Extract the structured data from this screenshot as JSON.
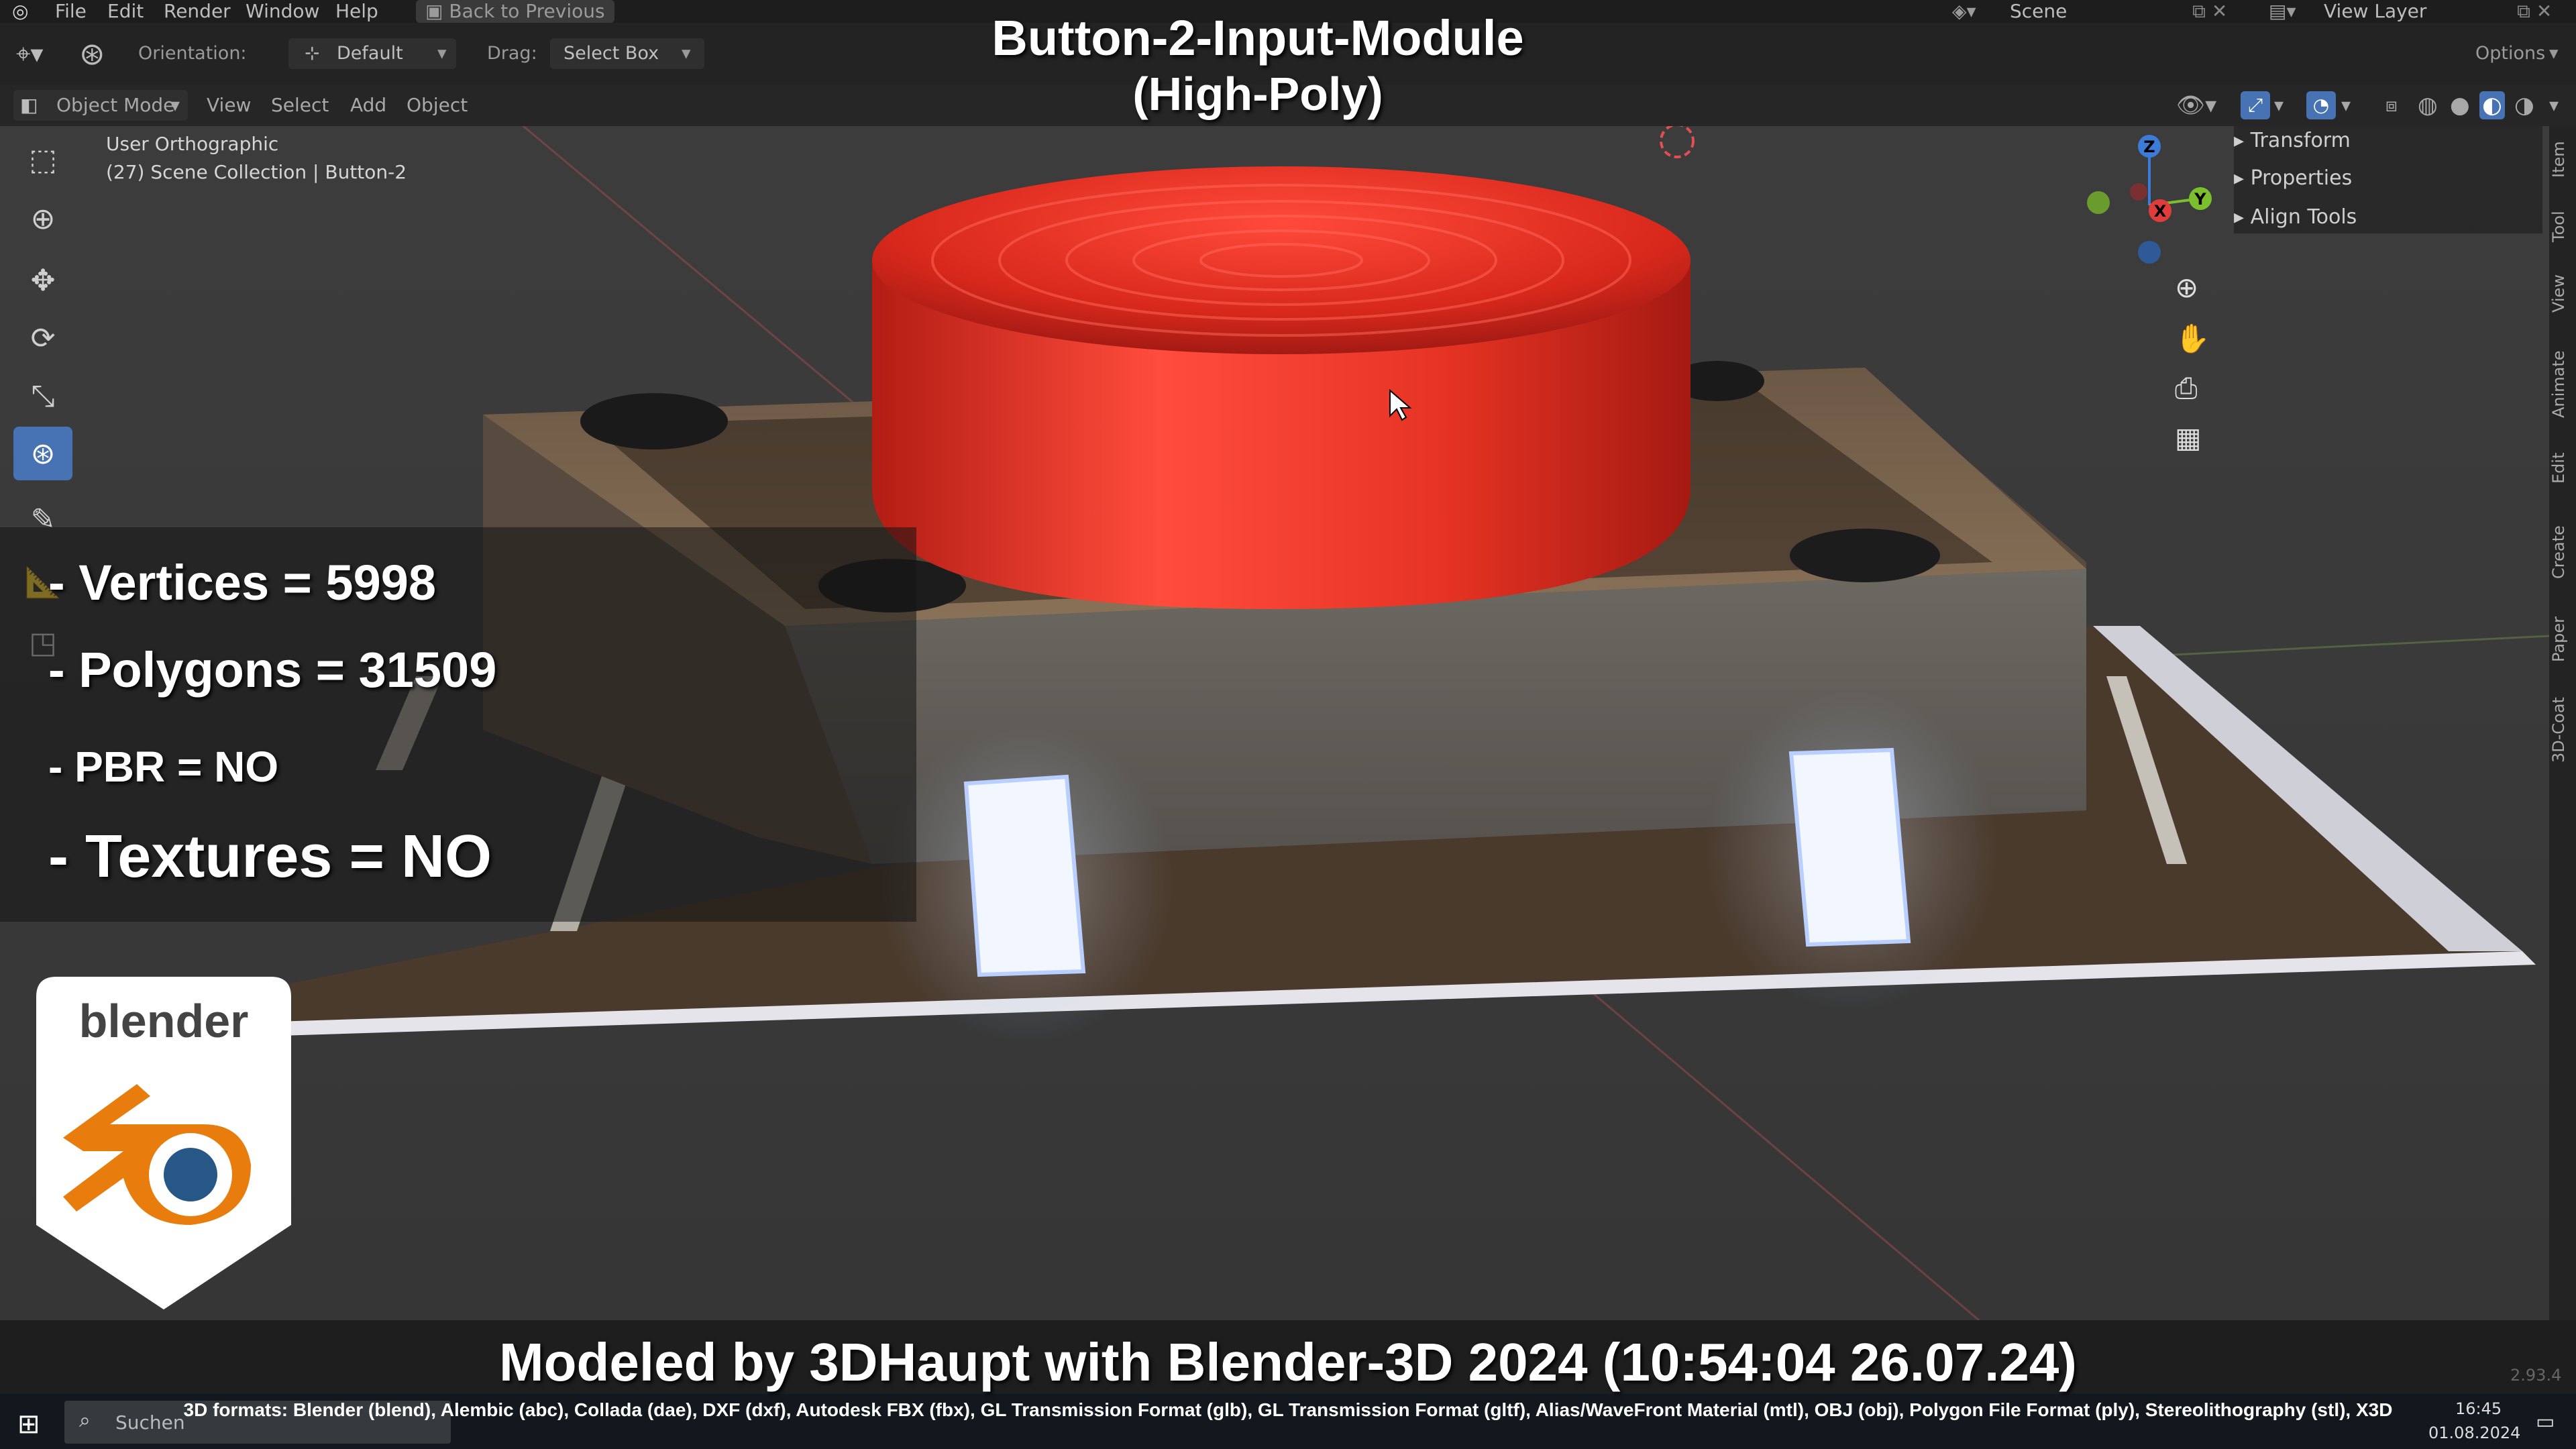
{
  "menu": {
    "items": [
      "File",
      "Edit",
      "Render",
      "Window",
      "Help"
    ],
    "back_label": "Back to Previous",
    "scene_label": "Scene",
    "view_layer_label": "View Layer"
  },
  "toolbar": {
    "orientation_label": "Orientation:",
    "orientation_value": "Default",
    "drag_label": "Drag:",
    "drag_value": "Select Box",
    "options_label": "Options"
  },
  "header": {
    "mode": "Object Mode",
    "menus": [
      "View",
      "Select",
      "Add",
      "Object"
    ]
  },
  "viewport": {
    "view_name": "User Orthographic",
    "collection": "(27) Scene Collection | Button-2"
  },
  "npanel": {
    "items": [
      "Transform",
      "Properties",
      "Align Tools"
    ]
  },
  "sidebar_tabs": [
    "Item",
    "Tool",
    "View",
    "Animate",
    "Edit",
    "Create",
    "Paper",
    "3D-Coat"
  ],
  "gizmo": {
    "x": "X",
    "y": "Y",
    "z": "Z"
  },
  "overlay": {
    "title_line1": "Button-2-Input-Module",
    "title_line2": "(High-Poly)",
    "stats": [
      "- Vertices = 5998",
      "- Polygons = 31509",
      "- PBR =  NO",
      "- Textures = NO"
    ],
    "credit": "Modeled by 3DHaupt with Blender-3D 2024 (10:54:04  26.07.24)",
    "formats": "3D formats: Blender (blend), Alembic (abc), Collada (dae), DXF (dxf), Autodesk FBX (fbx), GL Transmission Format (glb), GL Transmission Format (gltf), Alias/WaveFront Material (mtl), OBJ (obj), Polygon File Format (ply), Stereolithography (stl), X3D",
    "logo_text": "blender"
  },
  "taskbar": {
    "search_placeholder": "Suchen",
    "time": "16:45",
    "date": "01.08.2024",
    "version": "2.93.4"
  },
  "colors": {
    "button_red": "#e0261b",
    "housing": "#6b5a48",
    "accent_blue": "#4772b3",
    "blender_orange": "#e87d0d",
    "blender_blue": "#265787"
  }
}
